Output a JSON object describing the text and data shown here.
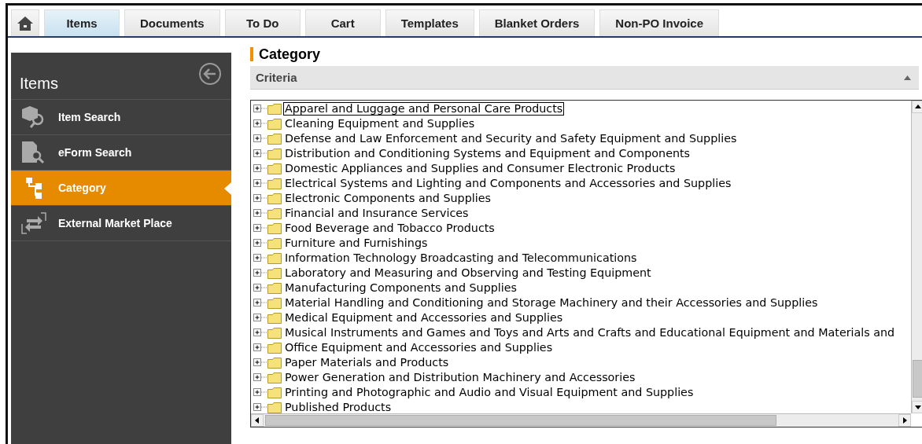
{
  "tabs": [
    {
      "kind": "home",
      "selected": false
    },
    {
      "kind": "text",
      "label": "Items",
      "selected": true
    },
    {
      "kind": "text",
      "label": "Documents",
      "selected": false
    },
    {
      "kind": "text",
      "label": "To Do",
      "selected": false
    },
    {
      "kind": "text",
      "label": "Cart",
      "selected": false
    },
    {
      "kind": "text",
      "label": "Templates",
      "selected": false
    },
    {
      "kind": "text",
      "label": "Blanket Orders",
      "selected": false
    },
    {
      "kind": "text",
      "label": "Non-PO Invoice",
      "selected": false
    }
  ],
  "sidebar": {
    "title": "Items",
    "items": [
      {
        "kind": "box",
        "label": "Item Search",
        "selected": false
      },
      {
        "kind": "form",
        "label": "eForm Search",
        "selected": false
      },
      {
        "kind": "tree",
        "label": "Category",
        "selected": true
      },
      {
        "kind": "exchange",
        "label": "External Market Place",
        "selected": false
      }
    ]
  },
  "main": {
    "title": "Category",
    "criteria": {
      "label": "Criteria",
      "expanded": true
    },
    "tree": {
      "items": [
        {
          "label": "Apparel and Luggage and Personal Care Products",
          "selected": true,
          "expanded": false
        },
        {
          "label": "Cleaning Equipment and Supplies",
          "selected": false,
          "expanded": false
        },
        {
          "label": "Defense and Law Enforcement and Security and Safety Equipment and Supplies",
          "selected": false,
          "expanded": false
        },
        {
          "label": "Distribution and Conditioning Systems and Equipment and Components",
          "selected": false,
          "expanded": false
        },
        {
          "label": "Domestic Appliances and Supplies and Consumer Electronic Products",
          "selected": false,
          "expanded": false
        },
        {
          "label": "Electrical Systems and Lighting and Components and Accessories and Supplies",
          "selected": false,
          "expanded": false
        },
        {
          "label": "Electronic Components and Supplies",
          "selected": false,
          "expanded": false
        },
        {
          "label": "Financial and Insurance Services",
          "selected": false,
          "expanded": false
        },
        {
          "label": "Food Beverage and Tobacco Products",
          "selected": false,
          "expanded": false
        },
        {
          "label": "Furniture and Furnishings",
          "selected": false,
          "expanded": false
        },
        {
          "label": "Information Technology Broadcasting and Telecommunications",
          "selected": false,
          "expanded": false
        },
        {
          "label": "Laboratory and Measuring and Observing and Testing Equipment",
          "selected": false,
          "expanded": false
        },
        {
          "label": "Manufacturing Components and Supplies",
          "selected": false,
          "expanded": false
        },
        {
          "label": "Material Handling and Conditioning and Storage Machinery and their Accessories and Supplies",
          "selected": false,
          "expanded": false
        },
        {
          "label": "Medical Equipment and Accessories and Supplies",
          "selected": false,
          "expanded": false
        },
        {
          "label": "Musical Instruments and Games and Toys and Arts and Crafts and Educational Equipment and Materials and",
          "selected": false,
          "expanded": false
        },
        {
          "label": "Office Equipment and Accessories and Supplies",
          "selected": false,
          "expanded": false
        },
        {
          "label": "Paper Materials and Products",
          "selected": false,
          "expanded": false
        },
        {
          "label": "Power Generation and Distribution Machinery and Accessories",
          "selected": false,
          "expanded": false
        },
        {
          "label": "Printing and Photographic and Audio and Visual Equipment and Supplies",
          "selected": false,
          "expanded": false
        },
        {
          "label": "Published Products",
          "selected": false,
          "expanded": false
        }
      ]
    }
  }
}
